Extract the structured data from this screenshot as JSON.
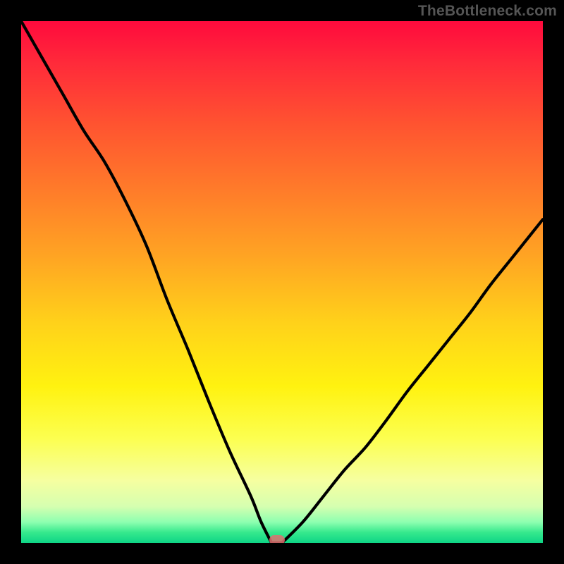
{
  "attribution": "TheBottleneck.com",
  "colors": {
    "page_bg": "#000000",
    "attribution_text": "#555555",
    "curve_stroke": "#000000",
    "marker_fill": "#e07070",
    "gradient_stops": [
      "#ff0a3d",
      "#ff2a3a",
      "#ff5430",
      "#ff7a2a",
      "#ffa423",
      "#ffd21a",
      "#fff210",
      "#fcff50",
      "#f6ffa0",
      "#d6ffb0",
      "#8effb0",
      "#36e98d",
      "#0ed586"
    ]
  },
  "chart_data": {
    "type": "line",
    "title": "",
    "xlabel": "",
    "ylabel": "",
    "xlim": [
      0,
      100
    ],
    "ylim": [
      0,
      100
    ],
    "grid": false,
    "legend": false,
    "annotations": [
      {
        "kind": "marker",
        "x": 49,
        "y": 0.5,
        "shape": "rounded-rect",
        "color": "#e07070"
      }
    ],
    "series": [
      {
        "name": "bottleneck-curve-left",
        "x": [
          0,
          4,
          8,
          12,
          16,
          20,
          24,
          28,
          32,
          36,
          40,
          44,
          46,
          48
        ],
        "values": [
          100,
          93,
          86,
          79,
          73,
          65.5,
          57,
          46.5,
          37,
          27,
          17.5,
          9,
          4,
          0
        ]
      },
      {
        "name": "bottleneck-curve-floor",
        "x": [
          48,
          50
        ],
        "values": [
          0,
          0
        ]
      },
      {
        "name": "bottleneck-curve-right",
        "x": [
          50,
          54,
          58,
          62,
          66,
          70,
          74,
          78,
          82,
          86,
          90,
          94,
          98,
          100
        ],
        "values": [
          0,
          4,
          9,
          14,
          18.3,
          23.5,
          29,
          34,
          39,
          44,
          49.5,
          54.5,
          59.5,
          62
        ]
      }
    ]
  }
}
